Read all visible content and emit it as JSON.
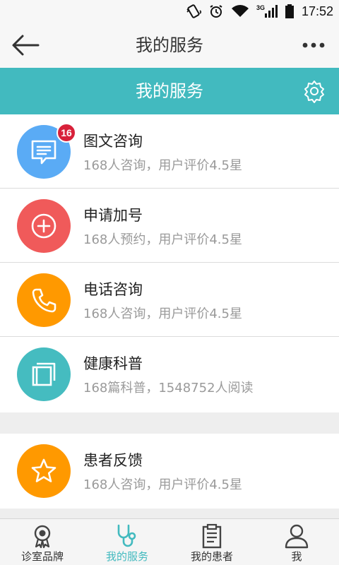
{
  "status_bar": {
    "time": "17:52",
    "network": "3G"
  },
  "app_bar": {
    "title": "我的服务",
    "back_icon": "arrow-left-icon",
    "more_icon": "more-dots-icon"
  },
  "banner": {
    "title": "我的服务",
    "settings_icon": "gear-icon"
  },
  "services": [
    {
      "name": "图文咨询",
      "desc": "168人咨询，用户评价4.5星",
      "badge": "16",
      "color": "#5aabf5",
      "icon": "message-icon"
    },
    {
      "name": "申请加号",
      "desc": "168人预约，用户评价4.5星",
      "color": "#f05a5a",
      "icon": "plus-circle-icon"
    },
    {
      "name": "电话咨询",
      "desc": "168人咨询，用户评价4.5星",
      "color": "#ff9900",
      "icon": "phone-icon"
    },
    {
      "name": "健康科普",
      "desc": "168篇科普，1548752人阅读",
      "color": "#45bcc0",
      "icon": "book-icon"
    }
  ],
  "feedback": {
    "name": "患者反馈",
    "desc": "168人咨询，用户评价4.5星",
    "color": "#ff9900",
    "icon": "star-icon"
  },
  "tabs": [
    {
      "label": "诊室品牌",
      "icon": "award-icon"
    },
    {
      "label": "我的服务",
      "icon": "stethoscope-icon",
      "active": true
    },
    {
      "label": "我的患者",
      "icon": "clipboard-icon"
    },
    {
      "label": "我",
      "icon": "user-icon"
    }
  ],
  "colors": {
    "accent": "#42babf",
    "badge": "#d8213a"
  }
}
